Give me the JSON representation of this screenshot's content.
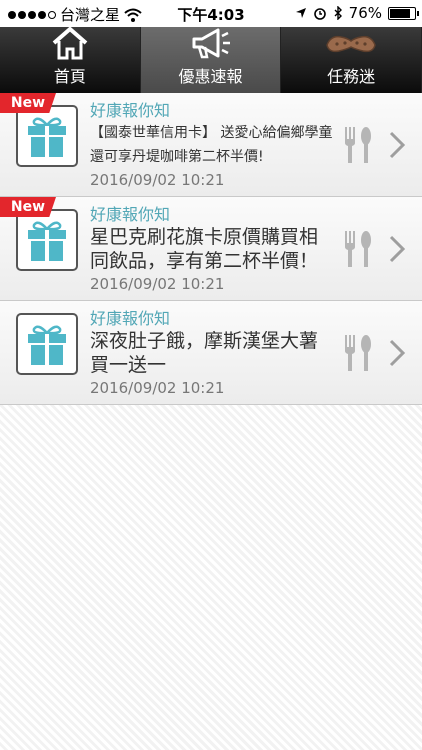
{
  "status_bar": {
    "carrier": "台灣之星",
    "time": "下午4:03",
    "battery": "76%"
  },
  "tabs": [
    {
      "label": "首頁",
      "icon": "home-icon",
      "active": false
    },
    {
      "label": "優惠速報",
      "icon": "megaphone-icon",
      "active": true
    },
    {
      "label": "任務迷",
      "icon": "mustache-icon",
      "active": false
    }
  ],
  "items": [
    {
      "is_new": true,
      "new_label": "New",
      "source": "好康報你知",
      "text": "【國泰世華信用卡】 送愛心給偏鄉學童 還可享丹堤咖啡第二杯半價!",
      "date": "2016/09/02 10:21"
    },
    {
      "is_new": true,
      "new_label": "New",
      "source": "好康報你知",
      "text": "星巴克刷花旗卡原價購買相同飲品，享有第二杯半價！",
      "date": "2016/09/02 10:21"
    },
    {
      "is_new": false,
      "source": "好康報你知",
      "text": "深夜肚子餓，摩斯漢堡大薯買一送一",
      "date": "2016/09/02 10:21"
    }
  ],
  "colors": {
    "accent_teal": "#4fb7c8",
    "new_badge_red": "#e3262c",
    "source_text": "#52a7b6"
  }
}
